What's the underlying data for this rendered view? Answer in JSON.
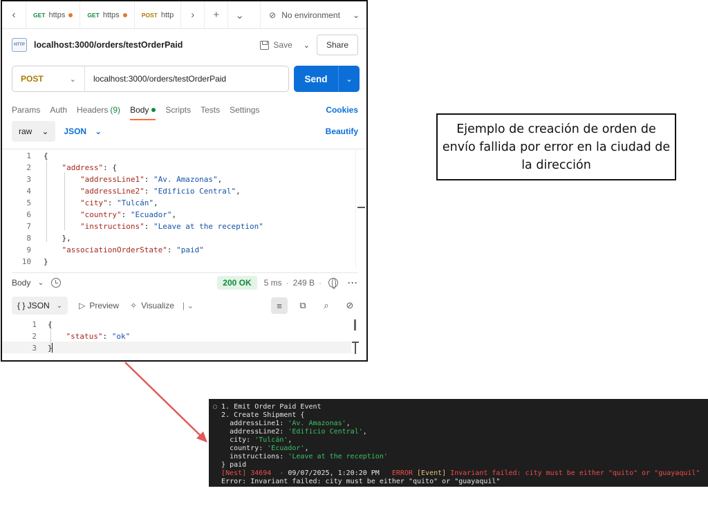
{
  "postman": {
    "tabs": [
      {
        "method": "GET",
        "label": "https"
      },
      {
        "method": "GET",
        "label": "https"
      },
      {
        "method": "POST",
        "label": "http"
      }
    ],
    "environment": "No environment",
    "request_name": "localhost:3000/orders/testOrderPaid",
    "save_label": "Save",
    "share_label": "Share",
    "method": "POST",
    "url": "localhost:3000/orders/testOrderPaid",
    "send_label": "Send",
    "request_tabs": {
      "params": "Params",
      "auth": "Auth",
      "headers": "Headers",
      "headers_count": "(9)",
      "body": "Body",
      "scripts": "Scripts",
      "tests": "Tests",
      "settings": "Settings",
      "cookies": "Cookies"
    },
    "body_type": "raw",
    "body_format": "JSON",
    "beautify": "Beautify",
    "request_body": [
      {
        "n": "1",
        "t": "{"
      },
      {
        "n": "2",
        "t": "    \"address\": {"
      },
      {
        "n": "3",
        "t": "        \"addressLine1\": \"Av. Amazonas\","
      },
      {
        "n": "4",
        "t": "        \"addressLine2\": \"Edificio Central\","
      },
      {
        "n": "5",
        "t": "        \"city\": \"Tulcán\","
      },
      {
        "n": "6",
        "t": "        \"country\": \"Ecuador\","
      },
      {
        "n": "7",
        "t": "        \"instructions\": \"Leave at the reception\""
      },
      {
        "n": "8",
        "t": "    },"
      },
      {
        "n": "9",
        "t": "    \"associationOrderState\": \"paid\""
      },
      {
        "n": "10",
        "t": "}"
      }
    ],
    "response": {
      "section": "Body",
      "status": "200 OK",
      "time": "5 ms",
      "size": "249 B",
      "format": "{ } JSON",
      "preview": "Preview",
      "visualize": "Visualize",
      "body": [
        {
          "n": "1",
          "t": "{"
        },
        {
          "n": "2",
          "t": "    \"status\": \"ok\""
        },
        {
          "n": "3",
          "t": "}"
        }
      ]
    }
  },
  "caption": "Ejemplo de creación de orden de envío fallida por error en la ciudad de la dirección",
  "terminal": {
    "lines": [
      "1. Emit Order Paid Event",
      "2. Create Shipment {",
      "  addressLine1: 'Av. Amazonas',",
      "  addressLine2: 'Edificio Central',",
      "  city: 'Tulcán',",
      "  country: 'Ecuador',",
      "  instructions: 'Leave at the reception'",
      "} paid"
    ],
    "nest_prefix": "[Nest] 34694  - ",
    "nest_time": "09/07/2025, 1:20:20 PM   ",
    "nest_level": "ERROR ",
    "nest_context": "[Event] ",
    "nest_message": "Invariant failed: city must be either \"quito\" or \"guayaquil\"",
    "error_line": "Error: Invariant failed: city must be either \"quito\" or \"guayaquil\""
  },
  "colors": {
    "accent": "#0c6fd8",
    "post_method": "#ad7a03",
    "status_ok": "#0f8a3b",
    "arrow": "#e05a5a",
    "terminal_bg": "#1e1e1e"
  }
}
